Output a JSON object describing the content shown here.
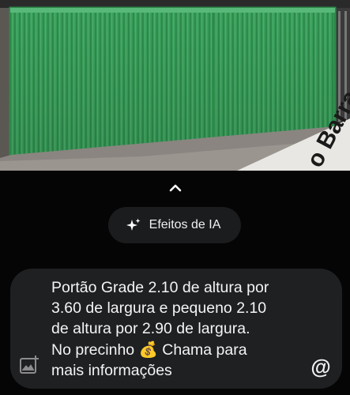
{
  "photo": {
    "description_icon": "gate-photo",
    "street_text": "o Barra"
  },
  "collapse_button": {
    "icon": "chevron-up-icon"
  },
  "ai_effects": {
    "icon": "sparkle-icon",
    "label": "Efeitos de IA"
  },
  "caption": {
    "text": "Portão Grade 2.10 de altura por\n3.60 de largura e pequeno 2.10\nde altura por 2.90 de largura.\nNo precinho 💰 Chama para\nmais informações"
  },
  "gallery_button": {
    "icon": "add-image-icon"
  },
  "mention_button": {
    "icon": "at-icon",
    "symbol": "@"
  },
  "colors": {
    "background": "#050505",
    "gate_green": "#3fae63",
    "pill_bg": "#1b1c1e",
    "caption_bg": "#1f2022",
    "text": "#f4f4f4"
  }
}
